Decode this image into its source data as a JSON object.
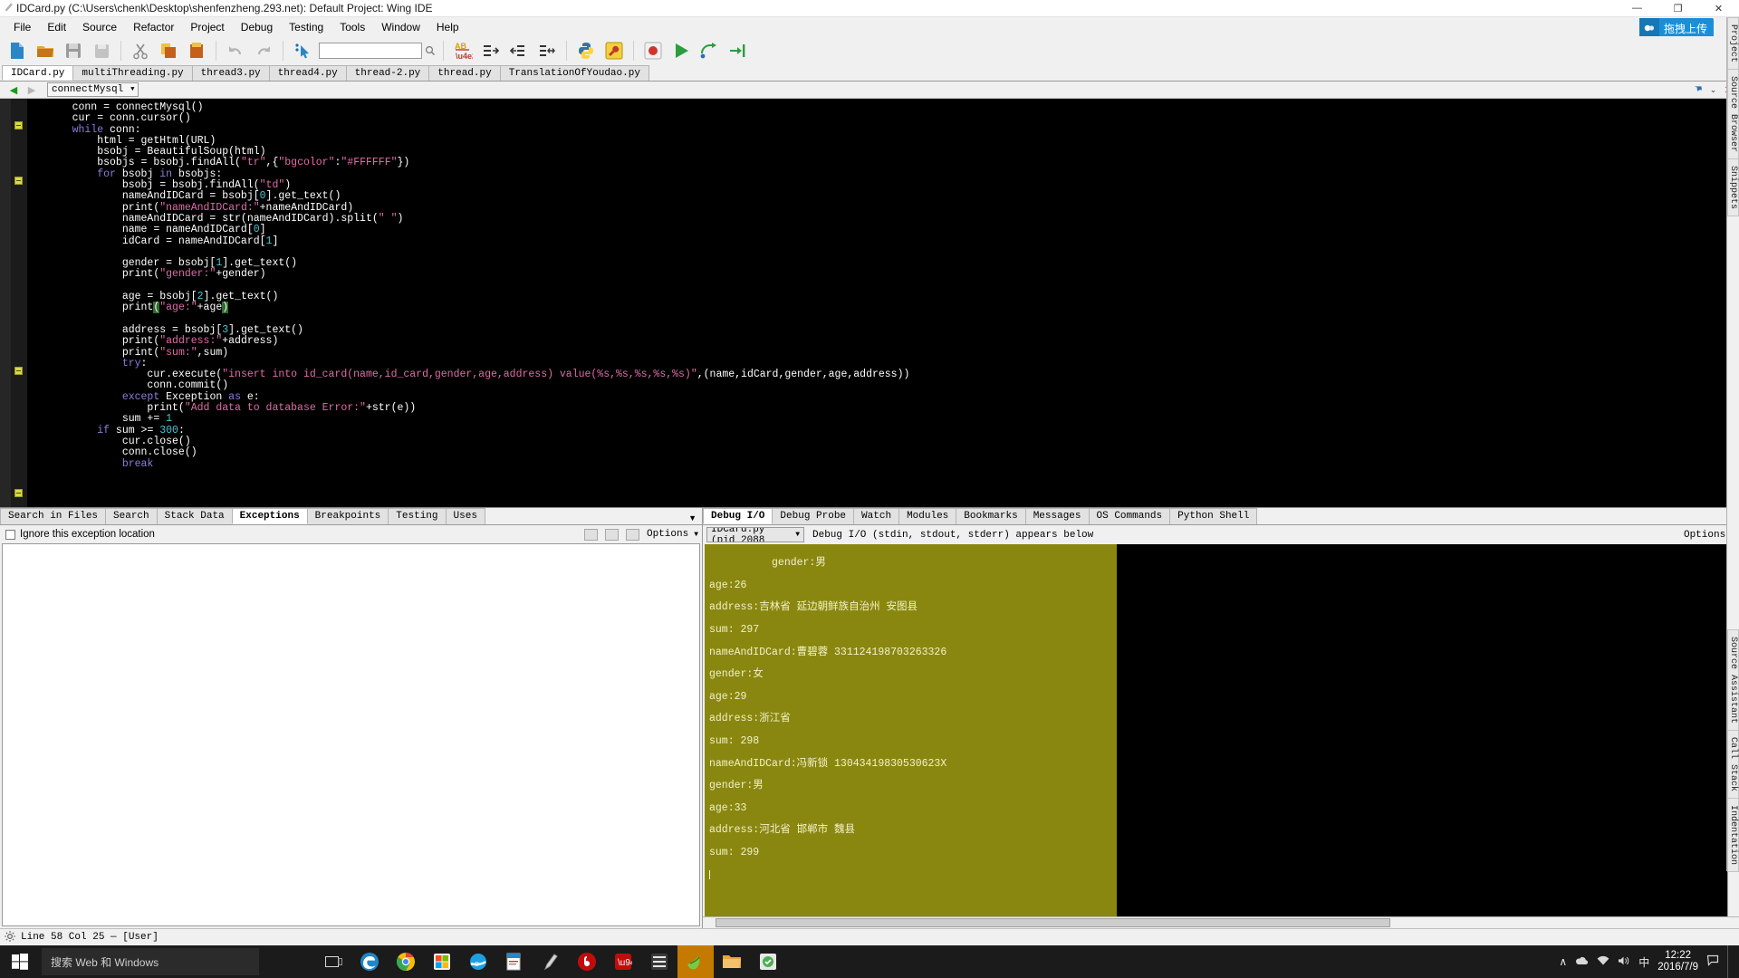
{
  "window": {
    "title": "IDCard.py (C:\\Users\\chenk\\Desktop\\shenfenzheng.293.net): Default Project: Wing IDE",
    "minimize": "—",
    "maximize": "❐",
    "close": "✕"
  },
  "menu": {
    "items": [
      {
        "label": "File"
      },
      {
        "label": "Edit"
      },
      {
        "label": "Source"
      },
      {
        "label": "Refactor"
      },
      {
        "label": "Project"
      },
      {
        "label": "Debug"
      },
      {
        "label": "Testing"
      },
      {
        "label": "Tools"
      },
      {
        "label": "Window"
      },
      {
        "label": "Help"
      }
    ]
  },
  "uploader": {
    "label": "拖拽上传"
  },
  "toolbar": {
    "search_value": "",
    "search_placeholder": "",
    "buttons": [
      {
        "name": "new-file-icon"
      },
      {
        "name": "open-file-icon"
      },
      {
        "name": "save-file-icon"
      },
      {
        "name": "save-as-icon"
      },
      {
        "name": "cut-icon"
      },
      {
        "name": "copy-icon"
      },
      {
        "name": "paste-icon"
      },
      {
        "name": "undo-icon"
      },
      {
        "name": "redo-icon"
      },
      {
        "name": "select-pointer-icon"
      },
      {
        "name": "search-magnifier-icon"
      },
      {
        "name": "replace-ab-icon"
      },
      {
        "name": "indent-right-icon"
      },
      {
        "name": "indent-left-icon"
      },
      {
        "name": "toggle-indent-icon"
      },
      {
        "name": "python-run-icon"
      },
      {
        "name": "debug-wrench-icon"
      },
      {
        "name": "stop-record-icon"
      },
      {
        "name": "run-play-icon"
      },
      {
        "name": "step-over-icon"
      },
      {
        "name": "step-into-icon"
      }
    ]
  },
  "file_tabs": [
    {
      "label": "IDCard.py",
      "active": true
    },
    {
      "label": "multiThreading.py",
      "active": false
    },
    {
      "label": "thread3.py",
      "active": false
    },
    {
      "label": "thread4.py",
      "active": false
    },
    {
      "label": "thread-2.py",
      "active": false
    },
    {
      "label": "thread.py",
      "active": false
    },
    {
      "label": "TranslationOfYoudao.py",
      "active": false
    }
  ],
  "editor_nav": {
    "back_arrow": "◀",
    "forward_arrow": "▶",
    "symbol_combo": "connectMysql",
    "combo_arrow": "▼",
    "pin_icon": "📌",
    "menu_arrow": "⌄",
    "close_icon": "✖"
  },
  "code": {
    "lines": [
      "    conn = connectMysql()",
      "    cur = conn.cursor()",
      "    while conn:",
      "        html = getHtml(URL)",
      "        bsobj = BeautifulSoup(html)",
      "        bsobjs = bsobj.findAll(\"tr\",{\"bgcolor\":\"#FFFFFF\"})",
      "        for bsobj in bsobjs:",
      "            bsobj = bsobj.findAll(\"td\")",
      "            nameAndIDCard = bsobj[0].get_text()",
      "            print(\"nameAndIDCard:\"+nameAndIDCard)",
      "            nameAndIDCard = str(nameAndIDCard).split(\" \")",
      "            name = nameAndIDCard[0]",
      "            idCard = nameAndIDCard[1]",
      "",
      "            gender = bsobj[1].get_text()",
      "            print(\"gender:\"+gender)",
      "",
      "            age = bsobj[2].get_text()",
      "            print(\"age:\"+age)",
      "",
      "            address = bsobj[3].get_text()",
      "            print(\"address:\"+address)",
      "            print(\"sum:\",sum)",
      "            try:",
      "                cur.execute(\"insert into id_card(name,id_card,gender,age,address) value(%s,%s,%s,%s,%s)\",(name,idCard,gender,age,address))",
      "                conn.commit()",
      "            except Exception as e:",
      "                print(\"Add data to database Error:\"+str(e))",
      "            sum += 1",
      "        if sum >= 300:",
      "            cur.close()",
      "            conn.close()",
      "            break"
    ]
  },
  "left_panel": {
    "tabs": [
      {
        "label": "Search in Files",
        "active": false
      },
      {
        "label": "Search",
        "active": false
      },
      {
        "label": "Stack Data",
        "active": false
      },
      {
        "label": "Exceptions",
        "active": true
      },
      {
        "label": "Breakpoints",
        "active": false
      },
      {
        "label": "Testing",
        "active": false
      },
      {
        "label": "Uses",
        "active": false
      }
    ],
    "collapse_arrow": "▼",
    "ignore_label": "Ignore this exception location",
    "ignore_checked": false,
    "options_label": "Options",
    "options_arrow": "▼"
  },
  "right_panel": {
    "tabs": [
      {
        "label": "Debug I/O",
        "active": true
      },
      {
        "label": "Debug Probe",
        "active": false
      },
      {
        "label": "Watch",
        "active": false
      },
      {
        "label": "Modules",
        "active": false
      },
      {
        "label": "Bookmarks",
        "active": false
      },
      {
        "label": "Messages",
        "active": false
      },
      {
        "label": "OS Commands",
        "active": false
      },
      {
        "label": "Python Shell",
        "active": false
      }
    ],
    "collapse_arrow": "▼",
    "process_combo": "IDCard.py (pid 2088",
    "process_arrow": "▼",
    "io_caption": "Debug I/O (stdin, stdout, stderr) appears below",
    "options_label": "Options",
    "options_arrow": "▼",
    "output_lines": [
      "gender:男",
      "age:26",
      "address:吉林省 延边朝鲜族自治州 安图县",
      "sum: 297",
      "nameAndIDCard:曹碧蓉 331124198703263326",
      "gender:女",
      "age:29",
      "address:浙江省",
      "sum: 298",
      "nameAndIDCard:冯新锁 13043419830530623X",
      "gender:男",
      "age:33",
      "address:河北省 邯郸市 魏县",
      "sum: 299"
    ]
  },
  "right_sidebar": {
    "tabs_top": [
      {
        "label": "Project"
      },
      {
        "label": "Source Browser"
      },
      {
        "label": "Snippets"
      }
    ],
    "tabs_bottom": [
      {
        "label": "Source Assistant"
      },
      {
        "label": "Call Stack"
      },
      {
        "label": "Indentation"
      }
    ],
    "scroll_up": "▲",
    "scroll_down": "▼"
  },
  "statusbar": {
    "icon": "gear-icon",
    "text": "Line 58 Col 25 — [User]"
  },
  "taskbar": {
    "start_icon": "windows-logo-icon",
    "search_placeholder": "搜索 Web 和 Windows",
    "icons": [
      {
        "name": "task-view-icon"
      },
      {
        "name": "edge-browser-icon"
      },
      {
        "name": "chrome-browser-icon"
      },
      {
        "name": "store-icon"
      },
      {
        "name": "ie-browser-icon"
      },
      {
        "name": "pdf-reader-icon"
      },
      {
        "name": "snip-pen-icon"
      },
      {
        "name": "netease-music-icon"
      },
      {
        "name": "dingtalk-icon"
      },
      {
        "name": "wunderlist-icon"
      },
      {
        "name": "wing-ide-icon"
      },
      {
        "name": "folder-explorer-icon"
      },
      {
        "name": "app-green-icon"
      }
    ],
    "tray": {
      "chevron": "∧",
      "network_icon": "network-icon",
      "volume_icon": "volume-icon",
      "battery_icon": "notification-icon",
      "ime": "中",
      "time": "12:22",
      "date": "2016/7/9"
    }
  },
  "colors": {
    "editor_bg": "#000000",
    "debug_io_bg": "#8a8710",
    "accent_blue": "#1a8fd8",
    "keyword": "#5b9bd5",
    "string": "#e06ca8",
    "number": "#46c8d8"
  }
}
